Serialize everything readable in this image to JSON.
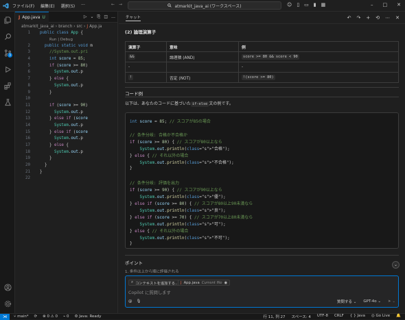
{
  "menu": {
    "file": "ファイル(F)",
    "edit": "編集(E)",
    "select": "選択(S)",
    "more": "···"
  },
  "command_center": {
    "label": "atmarkit_java_ai (ワークスペース)"
  },
  "editor": {
    "tab_label": "App.java",
    "tab_status": "U",
    "breadcrumb": [
      "atmarkit_java_ai",
      "branch",
      "src",
      "App.ja"
    ],
    "codelens": "Run | Debug",
    "lines": [
      {
        "n": "1",
        "code": "public class App {"
      },
      {
        "n": "2",
        "code": "  public static void m"
      },
      {
        "n": "3",
        "code": "    //System.out.pri"
      },
      {
        "n": "4",
        "code": "    int score = 85;"
      },
      {
        "n": "5",
        "code": "    if (score >= 80)"
      },
      {
        "n": "6",
        "code": "      System.out.p"
      },
      {
        "n": "7",
        "code": "    } else {"
      },
      {
        "n": "8",
        "code": "      System.out.p"
      },
      {
        "n": "9",
        "code": "    }"
      },
      {
        "n": "10",
        "code": ""
      },
      {
        "n": "11",
        "code": "    if (score >= 90)"
      },
      {
        "n": "12",
        "code": "      System.out.p"
      },
      {
        "n": "13",
        "code": "    } else if (score"
      },
      {
        "n": "14",
        "code": "      System.out.p"
      },
      {
        "n": "15",
        "code": "    } else if (score"
      },
      {
        "n": "16",
        "code": "      System.out.p"
      },
      {
        "n": "17",
        "code": "    } else {"
      },
      {
        "n": "18",
        "code": "      System.out.p"
      },
      {
        "n": "19",
        "code": "    }"
      },
      {
        "n": "20",
        "code": "  }"
      },
      {
        "n": "21",
        "code": "}"
      },
      {
        "n": "22",
        "code": ""
      }
    ]
  },
  "chat": {
    "tab_label": "チャット",
    "section_logical": "(2) 論理演算子",
    "table": {
      "headers": [
        "演算子",
        "意味",
        "例"
      ],
      "rows": [
        {
          "op": "&&",
          "meaning": "論理積 (AND)",
          "example": "score >= 80 && score < 90"
        },
        {
          "op": "-",
          "meaning": "",
          "example": "-"
        },
        {
          "op": "!",
          "meaning": "否定 (NOT)",
          "example": "!(score >= 80)"
        }
      ]
    },
    "section_code": "コード例",
    "intro_pre": "以下は、あなたのコードに基づいた",
    "intro_code": "if-else",
    "intro_post": "文の例です。",
    "code_lines": [
      "int score = 85; // スコアが85の場合",
      "",
      "// 条件分岐: 合格か不合格か",
      "if (score >= 80) { // スコアが80以上なら",
      "    System.out.println(\"合格\");",
      "} else { // それ以外の場合",
      "    System.out.println(\"不合格\");",
      "}",
      "",
      "// 条件分岐: 評価を出力",
      "if (score >= 90) { // スコアが90以上なら",
      "    System.out.println(\"優\");",
      "} else if (score >= 80) { // スコアが80以上90未満なら",
      "    System.out.println(\"良\");",
      "} else if (score >= 70) { // スコアが70以上80未満なら",
      "    System.out.println(\"可\");",
      "} else { // それ以外の場合",
      "    System.out.println(\"不可\");",
      "}"
    ],
    "section_points": "ポイント",
    "point_1": "1. 条件は上から順に評価される",
    "input": {
      "add_context": "コンテキストを追加する...",
      "file_chip": "App.java",
      "file_chip_note": "Current file",
      "placeholder": "Copilot に質問します",
      "mode": "質問する",
      "model": "GPT-4o"
    }
  },
  "status": {
    "branch": "main*",
    "problems": "0 ⚠ 0",
    "ports": "0",
    "java": "Java: Ready",
    "position": "行 11, 列 27",
    "spaces": "スペース: 4",
    "encoding": "UTF-8",
    "eol": "CRLF",
    "language": "Java",
    "golive": "Go Live"
  }
}
